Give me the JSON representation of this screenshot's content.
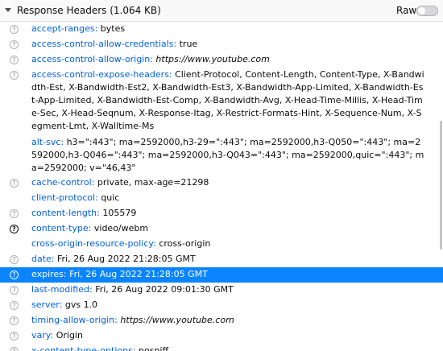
{
  "header": {
    "title": "Response Headers (1.064 KB)",
    "raw_label": "Raw"
  },
  "colors": {
    "link": "#0060df",
    "selection": "#0a84ff"
  },
  "rows": [
    {
      "name": "accept-ranges:",
      "value": "bytes",
      "icon": "help-icon",
      "italic": false,
      "selected": false
    },
    {
      "name": "access-control-allow-credentials:",
      "value": "true",
      "icon": "help-icon",
      "italic": false,
      "selected": false
    },
    {
      "name": "access-control-allow-origin:",
      "value": "https://www.youtube.com",
      "icon": "help-icon",
      "italic": true,
      "selected": false
    },
    {
      "name": "access-control-expose-headers:",
      "value": "Client-Protocol, Content-Length, Content-Type, X-Bandwidth-Est, X-Bandwidth-Est2, X-Bandwidth-Est3, X-Bandwidth-App-Limited, X-Bandwidth-Est-App-Limited, X-Bandwidth-Est-Comp, X-Bandwidth-Avg, X-Head-Time-Millis, X-Head-Time-Sec, X-Head-Seqnum, X-Response-Itag, X-Restrict-Formats-Hint, X-Sequence-Num, X-Segment-Lmt, X-Walltime-Ms",
      "icon": "help-icon",
      "italic": false,
      "selected": false
    },
    {
      "name": "alt-svc:",
      "value": "h3=\":443\"; ma=2592000,h3-29=\":443\"; ma=2592000,h3-Q050=\":443\"; ma=2592000,h3-Q046=\":443\"; ma=2592000,h3-Q043=\":443\"; ma=2592000,quic=\":443\"; ma=2592000; v=\"46,43\"",
      "icon": "none",
      "italic": false,
      "selected": false
    },
    {
      "name": "cache-control:",
      "value": "private, max-age=21298",
      "icon": "help-icon",
      "italic": false,
      "selected": false
    },
    {
      "name": "client-protocol:",
      "value": "quic",
      "icon": "none",
      "italic": false,
      "selected": false
    },
    {
      "name": "content-length:",
      "value": "105579",
      "icon": "help-icon",
      "italic": false,
      "selected": false
    },
    {
      "name": "content-type:",
      "value": "video/webm",
      "icon": "help-icon-dark",
      "italic": false,
      "selected": false
    },
    {
      "name": "cross-origin-resource-policy:",
      "value": "cross-origin",
      "icon": "none",
      "italic": false,
      "selected": false
    },
    {
      "name": "date:",
      "value": "Fri, 26 Aug 2022 21:28:05 GMT",
      "icon": "help-icon",
      "italic": false,
      "selected": false
    },
    {
      "name": "expires:",
      "value": "Fri, 26 Aug 2022 21:28:05 GMT",
      "icon": "help-icon",
      "italic": false,
      "selected": true
    },
    {
      "name": "last-modified:",
      "value": "Fri, 26 Aug 2022 09:01:30 GMT",
      "icon": "help-icon",
      "italic": false,
      "selected": false
    },
    {
      "name": "server:",
      "value": "gvs 1.0",
      "icon": "help-icon",
      "italic": false,
      "selected": false
    },
    {
      "name": "timing-allow-origin:",
      "value": "https://www.youtube.com",
      "icon": "help-icon",
      "italic": true,
      "selected": false
    },
    {
      "name": "vary:",
      "value": "Origin",
      "icon": "help-icon",
      "italic": false,
      "selected": false
    },
    {
      "name": "x-content-type-options:",
      "value": "nosniff",
      "icon": "help-icon",
      "italic": false,
      "selected": false
    }
  ]
}
